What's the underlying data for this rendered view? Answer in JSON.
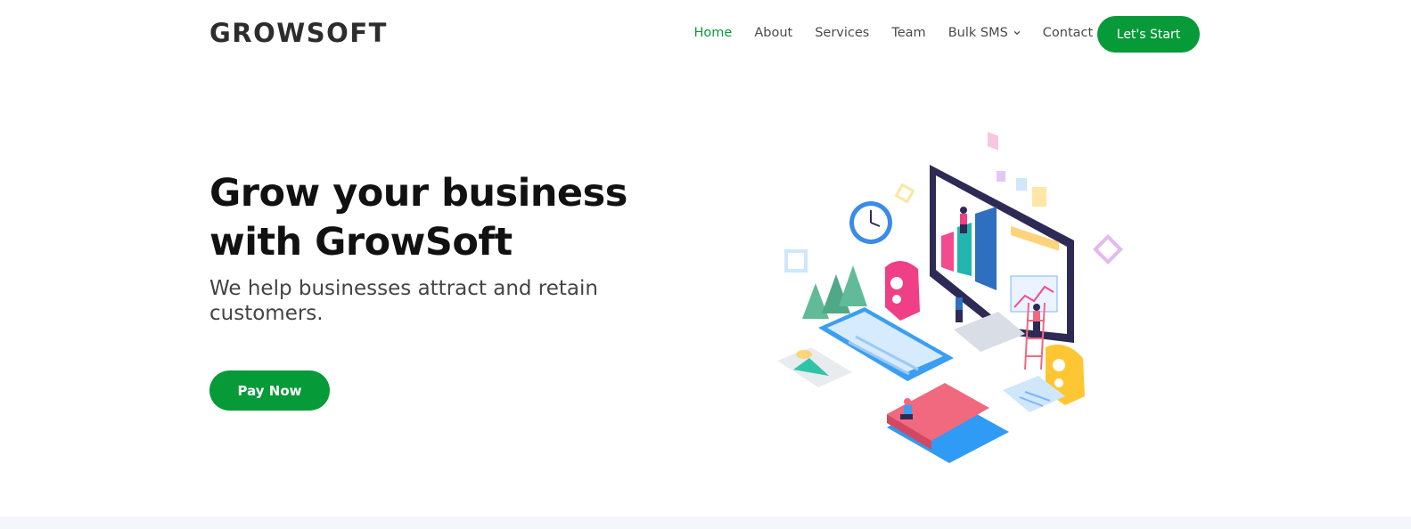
{
  "header": {
    "logo": "GROWSOFT",
    "nav": [
      {
        "label": "Home",
        "active": true
      },
      {
        "label": "About",
        "active": false
      },
      {
        "label": "Services",
        "active": false
      },
      {
        "label": "Team",
        "active": false
      },
      {
        "label": "Bulk SMS",
        "active": false,
        "dropdown": true
      },
      {
        "label": "Contact",
        "active": false
      }
    ],
    "cta_label": "Let's Start"
  },
  "hero": {
    "title": "Grow your business with GrowSoft",
    "subtitle": "We help businesses attract and retain customers.",
    "button_label": "Pay Now",
    "illustration": "isometric-business-growth-illustration"
  },
  "colors": {
    "accent": "#079a38",
    "nav_active": "#0a9a3b",
    "text_dark": "#111111",
    "text_muted": "#444444"
  },
  "icons": {
    "dropdown": "chevron-down-icon"
  }
}
